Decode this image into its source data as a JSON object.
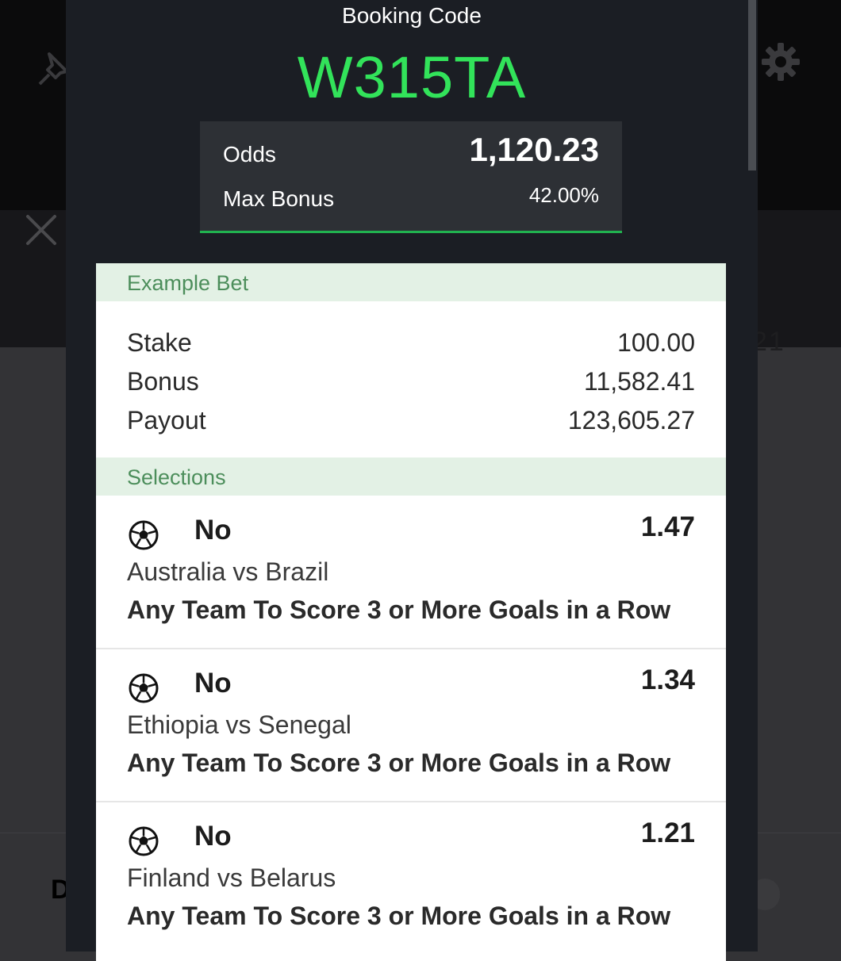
{
  "modal": {
    "booking_label": "Booking Code",
    "booking_code": "W315TA",
    "odds_label": "Odds",
    "odds_value": "1,120.23",
    "max_bonus_label": "Max Bonus",
    "max_bonus_value": "42.00%"
  },
  "example_bet": {
    "header": "Example Bet",
    "rows": [
      {
        "label": "Stake",
        "value": "100.00"
      },
      {
        "label": "Bonus",
        "value": "11,582.41"
      },
      {
        "label": "Payout",
        "value": "123,605.27"
      }
    ]
  },
  "selections": {
    "header": "Selections",
    "items": [
      {
        "icon": "soccer-ball-icon",
        "pick": "No",
        "odds": "1.47",
        "match": "Australia vs Brazil",
        "market": "Any Team To Score 3 or More Goals in a Row"
      },
      {
        "icon": "soccer-ball-icon",
        "pick": "No",
        "odds": "1.34",
        "match": "Ethiopia vs Senegal",
        "market": "Any Team To Score 3 or More Goals in a Row"
      },
      {
        "icon": "soccer-ball-icon",
        "pick": "No",
        "odds": "1.21",
        "match": "Finland vs Belarus",
        "market": "Any Team To Score 3 or More Goals in a Row"
      }
    ]
  },
  "background": {
    "partial_letter": "D",
    "partial_number": "21"
  },
  "colors": {
    "code_green": "#32e35a",
    "accent_green": "#21b24f",
    "section_header_bg": "#e3f1e5",
    "section_header_text": "#4c8e5b",
    "modal_bg": "#1b1e24"
  }
}
